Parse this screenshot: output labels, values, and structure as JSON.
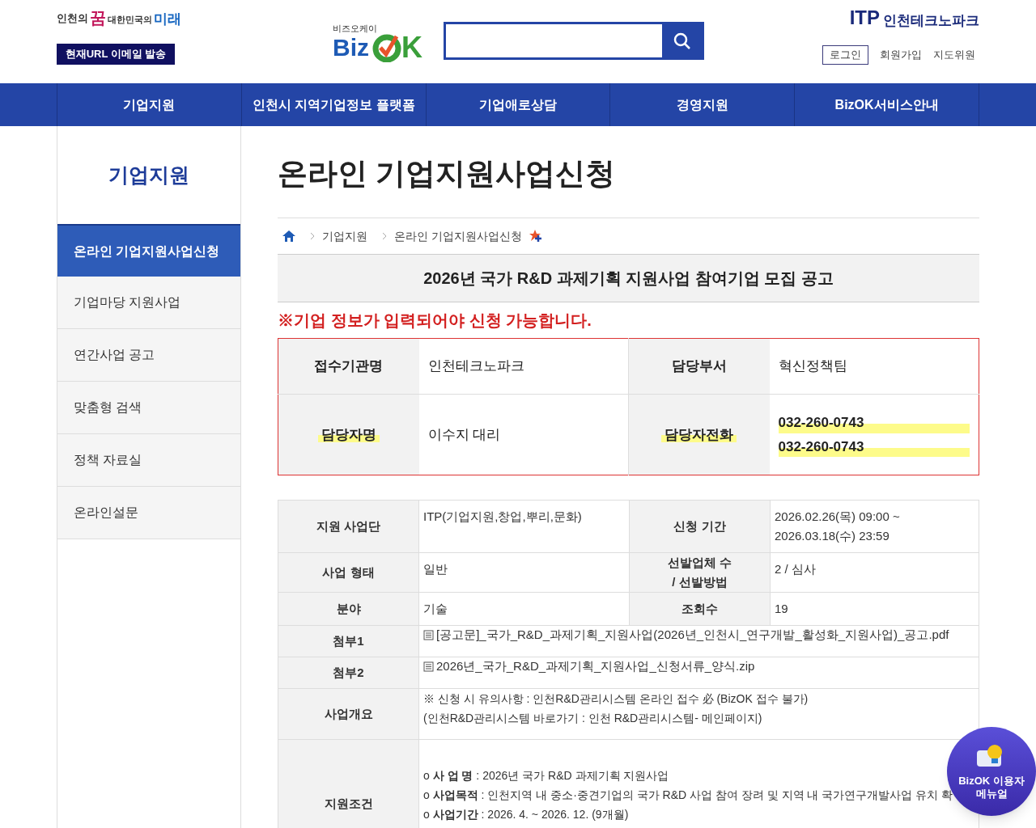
{
  "header": {
    "slogan": {
      "part_1": "인천의",
      "part_2": "꿈",
      "part_3": "대한민국의",
      "part_4": "미래"
    },
    "email_button": "현재URL 이메일 발송",
    "bizok_logo": {
      "caption": "비즈오케이",
      "word_1": "Biz",
      "word_2": "K"
    },
    "itp_logo": {
      "abbr": "ITP",
      "name": "인천테크노파크"
    },
    "links": [
      {
        "label": "로그인",
        "kind": "boxed"
      },
      {
        "label": "회원가입",
        "kind": "plain"
      },
      {
        "label": "지도위원",
        "kind": "plain"
      }
    ]
  },
  "nav": [
    "기업지원",
    "인천시 지역기업정보 플랫폼",
    "기업애로상담",
    "경영지원",
    "BizOK서비스안내"
  ],
  "sidebar": {
    "title": "기업지원",
    "items": [
      {
        "label": "온라인 기업지원사업신청",
        "selected": true
      },
      {
        "label": "기업마당 지원사업",
        "selected": false
      },
      {
        "label": "연간사업 공고",
        "selected": false
      },
      {
        "label": "맞춤형 검색",
        "selected": false
      },
      {
        "label": "정책 자료실",
        "selected": false
      },
      {
        "label": "온라인설문",
        "selected": false
      }
    ]
  },
  "page_title": "온라인 기업지원사업신청",
  "breadcrumb": [
    "기업지원",
    "온라인 기업지원사업신청"
  ],
  "notice_title": "2026년 국가 R&D 과제기획 지원사업 참여기업 모집 공고",
  "warning": "※기업 정보가 입력되어야 신청 가능합니다.",
  "contact": [
    [
      {
        "label": "접수기관명",
        "highlighted": false,
        "values": [
          {
            "text": "인천테크노파크",
            "highlighted": false
          }
        ]
      },
      {
        "label": "담당부서",
        "highlighted": false,
        "values": [
          {
            "text": "혁신정책팀",
            "highlighted": false
          }
        ]
      }
    ],
    [
      {
        "label": "담당자명",
        "highlighted": true,
        "values": [
          {
            "text": "이수지 대리",
            "highlighted": false
          }
        ]
      },
      {
        "label": "담당자전화",
        "highlighted": true,
        "values": [
          {
            "text": "032-260-0743",
            "highlighted": true
          },
          {
            "text": "032-260-0743",
            "highlighted": true
          }
        ]
      }
    ]
  ],
  "details": [
    {
      "kind": "pair",
      "cells": [
        {
          "label": [
            "지원 사업단"
          ],
          "value": [
            "ITP(기업지원,창업,뿌리,문화)"
          ]
        },
        {
          "label": [
            "신청 기간"
          ],
          "value": [
            "2026.02.26(목) 09:00 ~",
            "2026.03.18(수) 23:59"
          ]
        }
      ]
    },
    {
      "kind": "pair",
      "cells": [
        {
          "label": [
            "사업 형태"
          ],
          "value": [
            "일반"
          ]
        },
        {
          "label": [
            "선발업체 수",
            "/ 선발방법"
          ],
          "value": [
            "2 / 심사"
          ]
        }
      ]
    },
    {
      "kind": "pair",
      "cells": [
        {
          "label": [
            "분야"
          ],
          "value": [
            "기술"
          ]
        },
        {
          "label": [
            "조회수"
          ],
          "value": [
            "19"
          ]
        }
      ]
    },
    {
      "kind": "file",
      "label": "첨부1",
      "file": "[공고문]_국가_R&D_과제기획_지원사업(2026년_인천시_연구개발_활성화_지원사업)_공고.pdf"
    },
    {
      "kind": "file",
      "label": "첨부2",
      "file": "2026년_국가_R&D_과제기획_지원사업_신청서류_양식.zip"
    },
    {
      "kind": "text",
      "label": "사업개요",
      "lines": [
        "※ 신청 시 유의사항 : 인천R&D관리시스템 온라인 접수 必 (BizOK 접수 불가)",
        "(인천R&D관리시스템 바로가기 : 인천 R&D관리시스템- 메인페이지)"
      ]
    },
    {
      "kind": "text",
      "label": "지원조건",
      "lines": [
        "o **사 업 명** : 2026년 국가 R&D 과제기획 지원사업",
        "o **사업목적** : 인천지역 내 중소·중견기업의 국가 R&D 사업 참여 장려 및 지역 내 국가연구개발사업 유치 확",
        "o **사업기간** : 2026. 4. ~ 2026. 12. (9개월)"
      ]
    }
  ],
  "floating_button": {
    "line_1": "BizOK 이용자",
    "line_2": "메뉴얼"
  }
}
